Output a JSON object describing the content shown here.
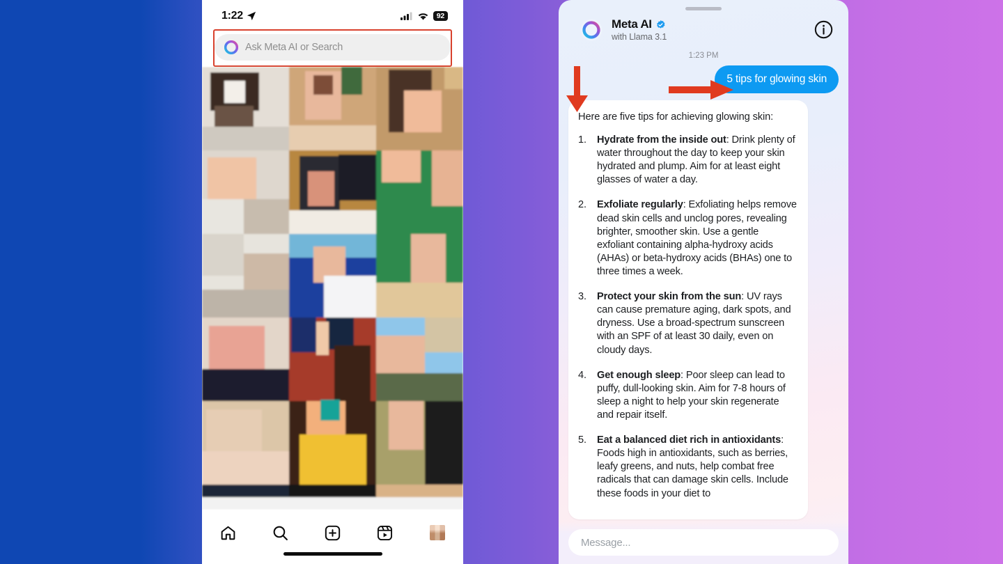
{
  "colors": {
    "accent_blue": "#0d9af2",
    "annotation_red": "#d8412d",
    "bg_gradient_start": "#0f47b3",
    "bg_gradient_end": "#cd72e8",
    "search_pill": "#efefef"
  },
  "left_phone": {
    "status_bar": {
      "time": "1:22",
      "location_icon": "location-arrow-icon",
      "cellular_icon": "cellular-signal-icon",
      "wifi_icon": "wifi-icon",
      "battery_level": "92"
    },
    "search": {
      "placeholder": "Ask Meta AI or Search",
      "icon": "meta-ai-ring-icon",
      "highlighted": true
    },
    "content": {
      "description": "blurred pixelated photo collage grid"
    },
    "nav": [
      {
        "name": "home",
        "icon": "home-icon"
      },
      {
        "name": "search",
        "icon": "search-icon"
      },
      {
        "name": "create",
        "icon": "plus-square-icon"
      },
      {
        "name": "reels",
        "icon": "reels-icon"
      },
      {
        "name": "profile",
        "icon": "avatar-icon"
      }
    ]
  },
  "right_phone": {
    "grabber": "sheet-grabber",
    "header": {
      "title": "Meta AI",
      "verified": true,
      "subtitle": "with Llama 3.1",
      "avatar_icon": "meta-ai-ring-icon",
      "info_icon": "info-circle-icon"
    },
    "timestamp": "1:23 PM",
    "user_message": "5 tips for glowing skin",
    "ai_response": {
      "intro": "Here are five tips for achieving glowing skin:",
      "tips": [
        {
          "num": "1.",
          "title": "Hydrate from the inside out",
          "body": ": Drink plenty of water throughout the day to keep your skin hydrated and plump. Aim for at least eight glasses of water a day."
        },
        {
          "num": "2.",
          "title": "Exfoliate regularly",
          "body": ": Exfoliating helps remove dead skin cells and unclog pores, revealing brighter, smoother skin. Use a gentle exfoliant containing alpha-hydroxy acids (AHAs) or beta-hydroxy acids (BHAs) one to three times a week."
        },
        {
          "num": "3.",
          "title": "Protect your skin from the sun",
          "body": ": UV rays can cause premature aging, dark spots, and dryness. Use a broad-spectrum sunscreen with an SPF of at least 30 daily, even on cloudy days."
        },
        {
          "num": "4.",
          "title": "Get enough sleep",
          "body": ": Poor sleep can lead to puffy, dull-looking skin. Aim for 7-8 hours of sleep a night to help your skin regenerate and repair itself."
        },
        {
          "num": "5.",
          "title": "Eat a balanced diet rich in antioxidants",
          "body": ": Foods high in antioxidants, such as berries, leafy greens, and nuts, help combat free radicals that can damage skin cells. Include these foods in your diet to"
        }
      ]
    },
    "message_input": {
      "placeholder": "Message..."
    }
  },
  "annotations": {
    "search_box_highlight": "red-rectangle-outline",
    "arrow_down": "red-down-arrow",
    "arrow_right": "red-right-arrow"
  }
}
